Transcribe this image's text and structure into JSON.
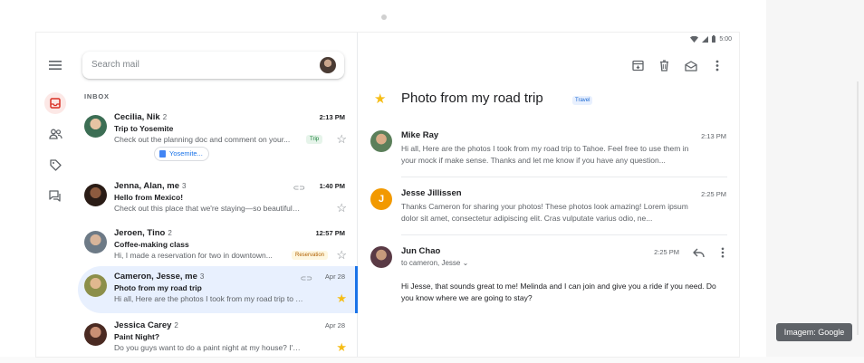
{
  "search": {
    "placeholder": "Search mail"
  },
  "list": {
    "section_label": "INBOX",
    "rows": [
      {
        "sender": "Cecilia, Nik",
        "count": "2",
        "time": "2:13 PM",
        "subject": "Trip to Yosemite",
        "snippet": "Check out the planning doc and comment on your...",
        "tag": "Trip",
        "attachment": "Yosemite...",
        "starred": false
      },
      {
        "sender": "Jenna, Alan, me",
        "count": "3",
        "time": "1:40 PM",
        "subject": "Hello from Mexico!",
        "snippet": "Check out this place that we're staying—so beautiful! We...",
        "starred": false
      },
      {
        "sender": "Jeroen, Tino",
        "count": "2",
        "time": "12:57 PM",
        "subject": "Coffee-making class",
        "snippet": "Hi, I made a reservation for two in downtown...",
        "tag": "Reservation",
        "starred": false
      },
      {
        "sender": "Cameron, Jesse, me",
        "count": "3",
        "time": "Apr 28",
        "subject": "Photo from my road trip",
        "snippet": "Hi all, Here are the photos I took from my road trip to Ta...",
        "starred": true,
        "selected": true
      },
      {
        "sender": "Jessica Carey",
        "count": "2",
        "time": "Apr 28",
        "subject": "Paint Night?",
        "snippet": "Do you guys want to do a paint night at my house? I'm th...",
        "starred": true
      }
    ]
  },
  "status_bar": {
    "time": "5:00"
  },
  "reading": {
    "title": "Photo from my road trip",
    "tag": "Travel",
    "messages": [
      {
        "name": "Mike Ray",
        "time": "2:13 PM",
        "body": "Hi all, Here are the photos I took from my road trip to Tahoe. Feel free to use them in your mock if make sense. Thanks and let me know if you have any question..."
      },
      {
        "name": "Jesse Jillissen",
        "time": "2:25 PM",
        "initial": "J",
        "body": "Thanks Cameron for sharing your photos! These photos look amazing! Lorem ipsum dolor sit amet, consectetur adipiscing elit. Cras vulputate varius odio, ne..."
      },
      {
        "name": "Jun Chao",
        "time": "2:25 PM",
        "to": "to cameron, Jesse",
        "body": "Hi Jesse, that sounds great to me! Melinda and I can join and give you a ride if you need. Do you know where we are going to stay?"
      }
    ]
  },
  "credit": "Imagem: Google",
  "colors": {
    "accent": "#1a73e8",
    "star": "#f6bd16",
    "selected_row": "#e8f0fe",
    "inbox_icon": "#d93025",
    "avatar_orange": "#f29900"
  }
}
